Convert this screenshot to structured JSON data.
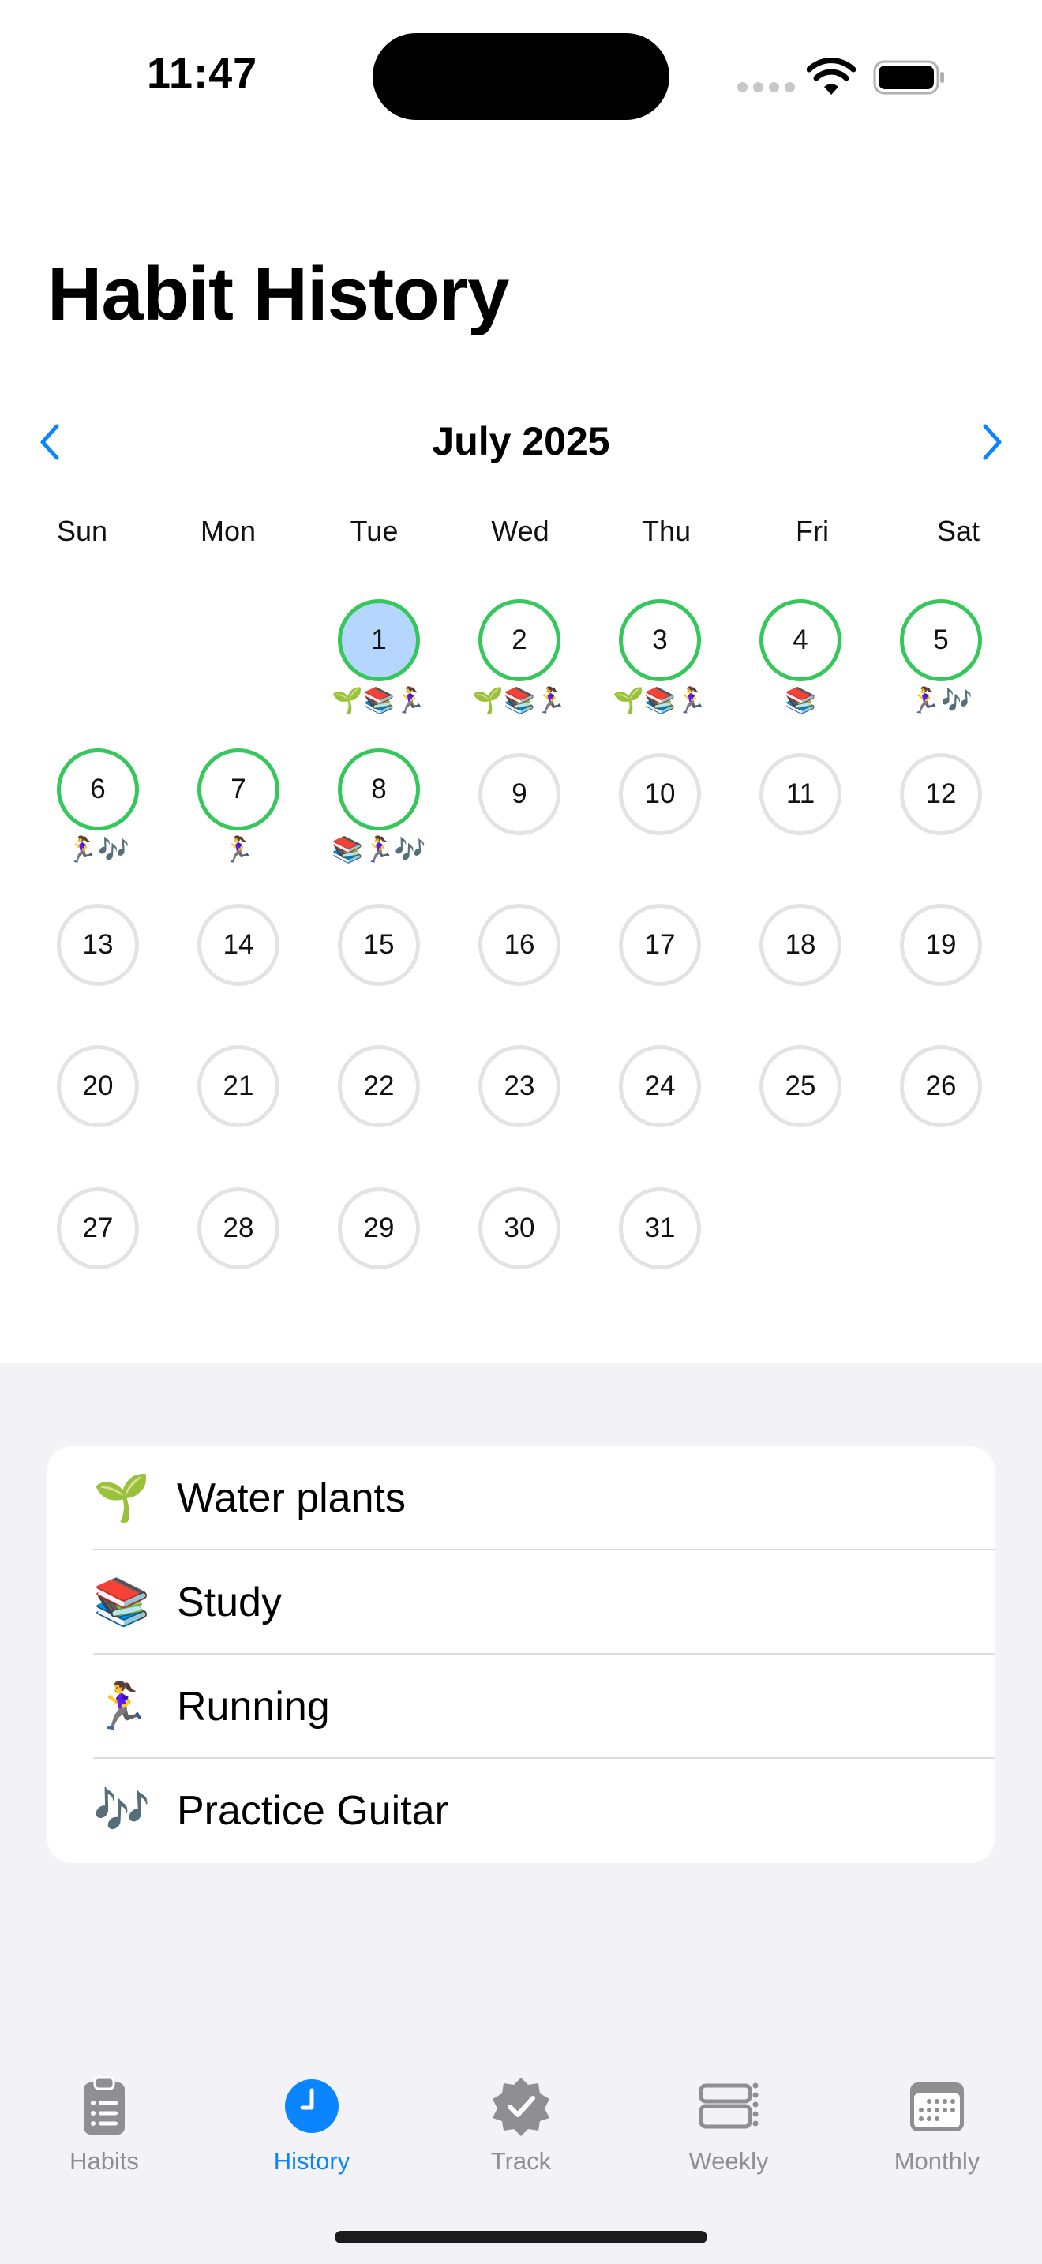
{
  "status": {
    "time": "11:47"
  },
  "title": "Habit History",
  "calendar": {
    "month": "July 2025",
    "weekdays": [
      "Sun",
      "Mon",
      "Tue",
      "Wed",
      "Thu",
      "Fri",
      "Sat"
    ],
    "days": [
      {
        "n": "1",
        "emojis": "🌱📚🏃‍♀️",
        "done": true,
        "selected": true
      },
      {
        "n": "2",
        "emojis": "🌱📚🏃‍♀️",
        "done": true
      },
      {
        "n": "3",
        "emojis": "🌱📚🏃‍♀️",
        "done": true
      },
      {
        "n": "4",
        "emojis": "📚",
        "done": true
      },
      {
        "n": "5",
        "emojis": "🏃‍♀️🎶",
        "done": true
      },
      {
        "n": "6",
        "emojis": "🏃‍♀️🎶",
        "done": true
      },
      {
        "n": "7",
        "emojis": "🏃‍♀️",
        "done": true
      },
      {
        "n": "8",
        "emojis": "📚🏃‍♀️🎶",
        "done": true
      },
      {
        "n": "9"
      },
      {
        "n": "10"
      },
      {
        "n": "11"
      },
      {
        "n": "12"
      },
      {
        "n": "13"
      },
      {
        "n": "14"
      },
      {
        "n": "15"
      },
      {
        "n": "16"
      },
      {
        "n": "17"
      },
      {
        "n": "18"
      },
      {
        "n": "19"
      },
      {
        "n": "20"
      },
      {
        "n": "21"
      },
      {
        "n": "22"
      },
      {
        "n": "23"
      },
      {
        "n": "24"
      },
      {
        "n": "25"
      },
      {
        "n": "26"
      },
      {
        "n": "27"
      },
      {
        "n": "28"
      },
      {
        "n": "29"
      },
      {
        "n": "30"
      },
      {
        "n": "31"
      }
    ]
  },
  "habits": [
    {
      "emoji": "🌱",
      "name": "Water plants"
    },
    {
      "emoji": "📚",
      "name": "Study"
    },
    {
      "emoji": "🏃‍♀️",
      "name": "Running"
    },
    {
      "emoji": "🎶",
      "name": "Practice Guitar"
    }
  ],
  "tabs": [
    {
      "label": "Habits",
      "icon": "list-clipboard-icon"
    },
    {
      "label": "History",
      "icon": "clock-icon",
      "active": true
    },
    {
      "label": "Track",
      "icon": "checkmark-seal-icon"
    },
    {
      "label": "Weekly",
      "icon": "weekly-calendar-icon"
    },
    {
      "label": "Monthly",
      "icon": "monthly-calendar-icon"
    }
  ],
  "colors": {
    "accent": "#0a84ff",
    "done": "#34c759",
    "selected": "#b5d6ff",
    "empty": "#e3e3e6",
    "inactive_tab": "#8e8e93"
  }
}
